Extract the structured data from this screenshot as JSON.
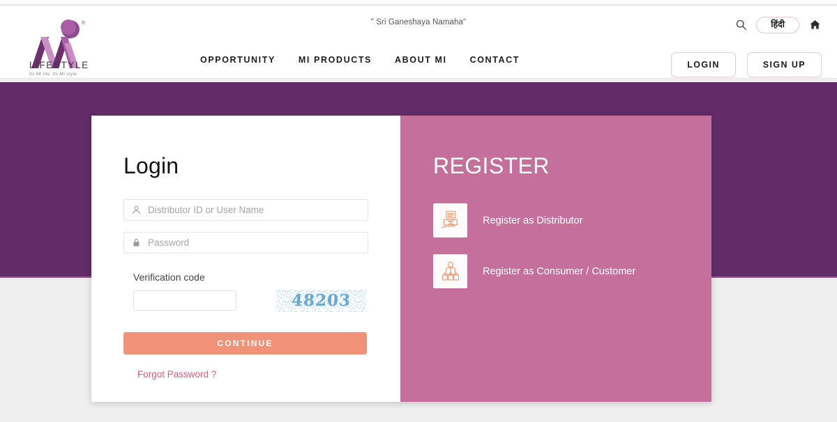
{
  "header": {
    "mantra": "\" Sri Ganeshaya Namaha\"",
    "logo": {
      "name": "LIFESTYLE",
      "tagline": "Its MI life. Its MI style"
    },
    "nav": [
      {
        "label": "OPPORTUNITY",
        "name": "nav-opportunity"
      },
      {
        "label": "MI PRODUCTS",
        "name": "nav-mi-products"
      },
      {
        "label": "ABOUT MI",
        "name": "nav-about-mi"
      },
      {
        "label": "CONTACT",
        "name": "nav-contact"
      }
    ],
    "utils": {
      "search_icon": "search-icon",
      "language_label": "हिंदी",
      "home_icon": "home-icon"
    },
    "auth": {
      "login_label": "LOGIN",
      "signup_label": "SIGN UP"
    }
  },
  "login": {
    "title": "Login",
    "username_placeholder": "Distributor ID or User Name",
    "username_value": "",
    "username_icon": "user-icon",
    "password_placeholder": "Password",
    "password_value": "",
    "password_icon": "lock-icon",
    "verification_label": "Verification code",
    "verification_value": "",
    "captcha_text": "48203",
    "continue_label": "CONTINUE",
    "forgot_label": "Forgot Password ?"
  },
  "register": {
    "title": "REGISTER",
    "options": [
      {
        "label": "Register as Distributor",
        "icon": "package-in-hand-icon"
      },
      {
        "label": "Register as Consumer / Customer",
        "icon": "shopper-with-bags-icon"
      }
    ]
  },
  "colors": {
    "purple_band": "#622c68",
    "pink_panel": "#c4709a",
    "continue_button": "#ef9277",
    "forgot_link": "#e8537e",
    "page_background": "#efefef"
  }
}
